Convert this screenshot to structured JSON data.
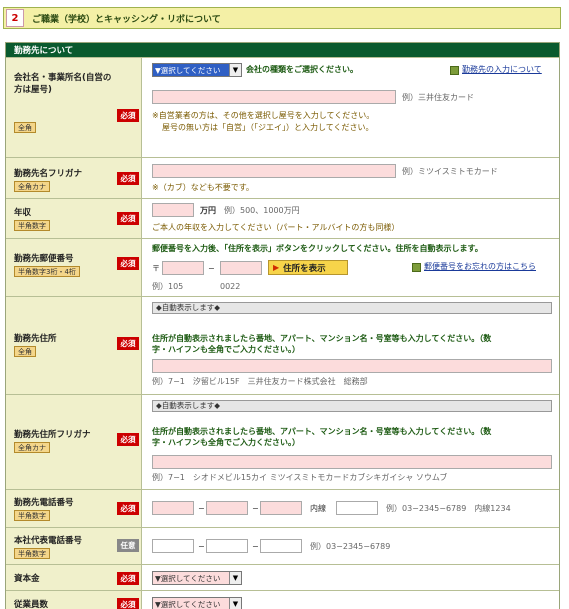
{
  "section": {
    "number": "2",
    "title": "ご職業（学校）とキャッシング・リボについて"
  },
  "table_caption": "勤務先について",
  "badges": {
    "required": "必須",
    "optional": "任意"
  },
  "rows": {
    "company": {
      "label": "会社名・事業所名(自営の方は屋号)",
      "tag": "全角",
      "select_value": "▼選択してください",
      "select_hint": "会社の種類をご選択ください。",
      "link": "勤務先の入力について",
      "example": "例）三井住友カード",
      "note1": "※自営業者の方は、その他を選択し屋号を入力してください。",
      "note2": "屋号の無い方は「自営」（「ジエイ」）と入力してください。"
    },
    "company_kana": {
      "label": "勤務先名フリガナ",
      "tag": "全角カナ",
      "example": "例）ミツイスミトモカード",
      "note": "※（カブ）なども不要です。"
    },
    "income": {
      "label": "年収",
      "tag": "半角数字",
      "unit": "万円",
      "example": "例）500、1000万円",
      "note": "ご本人の年収を入力してください（パート・アルバイトの方も同様）"
    },
    "zip": {
      "label": "勤務先郵便番号",
      "tag": "半角数字3桁・4桁",
      "instruction": "郵便番号を入力後、「住所を表示」ボタンをクリックしてください。住所を自動表示します。",
      "mark": "〒",
      "dash": "−",
      "button": "住所を表示",
      "link": "郵便番号をお忘れの方はこちら",
      "example1": "例）105",
      "example2": "0022"
    },
    "address": {
      "label": "勤務先住所",
      "tag": "全角",
      "auto": "◆自動表示します◆",
      "instruction1": "住所が自動表示されましたら番地、アパート、マンション名・号室等も入力してください。（数",
      "instruction2": "字・ハイフンも全角でご入力ください。）",
      "example": "例）7−1　汐留ビル15F　三井住友カード株式会社　総務部"
    },
    "address_kana": {
      "label": "勤務先住所フリガナ",
      "tag": "全角カナ",
      "auto": "◆自動表示します◆",
      "instruction1": "住所が自動表示されましたら番地、アパート、マンション名・号室等も入力してください。（数",
      "instruction2": "字・ハイフンも全角でご入力ください。）",
      "example": "例）7−1　シオドメビル15カイ ミツイスミトモカードカブシキガイシャ ソウムブ"
    },
    "phone": {
      "label": "勤務先電話番号",
      "tag": "半角数字",
      "dash": "−",
      "ext": "内線",
      "example": "例）03−2345−6789　内線1234"
    },
    "hq_phone": {
      "label": "本社代表電話番号",
      "tag": "半角数字",
      "dash": "−",
      "example": "例）03−2345−6789"
    },
    "capital": {
      "label": "資本金",
      "select_value": "▼選択してください"
    },
    "employees": {
      "label": "従業員数",
      "select_value": "▼選択してください"
    }
  }
}
